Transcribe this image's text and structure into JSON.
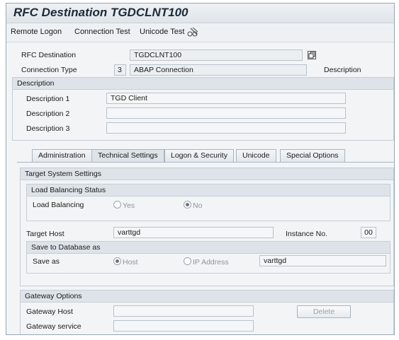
{
  "window": {
    "title": "RFC Destination TGDCLNT100"
  },
  "toolbar": {
    "remote_logon": "Remote Logon",
    "connection_test": "Connection Test",
    "unicode_test": "Unicode Test",
    "test_icon": "pencil-glasses-icon"
  },
  "header": {
    "rfc_destination_label": "RFC Destination",
    "rfc_destination_value": "TGDCLNT100",
    "connection_type_label": "Connection Type",
    "connection_type_code": "3",
    "connection_type_text": "ABAP Connection",
    "description_label": "Description"
  },
  "description": {
    "title": "Description",
    "d1_label": "Description 1",
    "d1_value": "TGD Client",
    "d2_label": "Description 2",
    "d2_value": "",
    "d3_label": "Description 3",
    "d3_value": ""
  },
  "tabs": [
    {
      "label": "Administration"
    },
    {
      "label": "Technical Settings",
      "active": true
    },
    {
      "label": "Logon & Security"
    },
    {
      "label": "Unicode"
    },
    {
      "label": "Special Options"
    }
  ],
  "target": {
    "title": "Target System Settings",
    "lb_group_title": "Load Balancing Status",
    "lb_label": "Load Balancing",
    "lb_yes": "Yes",
    "lb_no": "No",
    "lb_selected": "No",
    "host_label": "Target Host",
    "host_value": "varttgd",
    "instance_label": "Instance No.",
    "instance_value": "00",
    "save_group_title": "Save to Database as",
    "save_label": "Save as",
    "save_host": "Host",
    "save_ip": "IP Address",
    "save_selected": "Host",
    "save_value": "varttgd"
  },
  "gateway": {
    "title": "Gateway Options",
    "host_label": "Gateway Host",
    "host_value": "",
    "service_label": "Gateway service",
    "service_value": "",
    "delete_label": "Delete"
  }
}
